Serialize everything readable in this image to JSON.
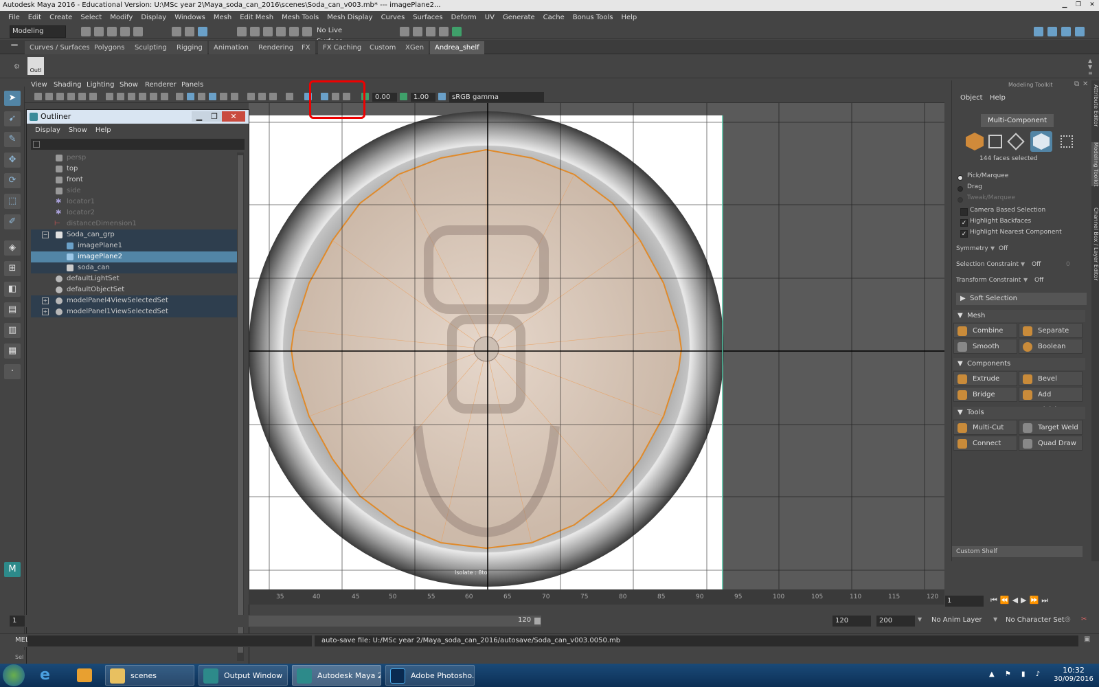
{
  "window": {
    "title": "Autodesk Maya 2016 - Educational Version: U:\\MSc year 2\\Maya_soda_can_2016\\scenes\\Soda_can_v003.mb*  ---  imagePlane2..."
  },
  "menubar": [
    "File",
    "Edit",
    "Create",
    "Select",
    "Modify",
    "Display",
    "Windows",
    "Mesh",
    "Edit Mesh",
    "Mesh Tools",
    "Mesh Display",
    "Curves",
    "Surfaces",
    "Deform",
    "UV",
    "Generate",
    "Cache",
    "Bonus Tools",
    "Help"
  ],
  "statusline": {
    "mode": "Modeling",
    "live_surface": "No Live Surface"
  },
  "shelf_tabs": [
    "Curves / Surfaces",
    "Polygons",
    "Sculpting",
    "Rigging",
    "Animation",
    "Rendering",
    "FX",
    "FX Caching",
    "Custom",
    "XGen",
    "Andrea_shelf"
  ],
  "shelf_icon_label": "Outl",
  "viewport": {
    "menu": [
      "View",
      "Shading",
      "Lighting",
      "Show",
      "Renderer",
      "Panels"
    ],
    "exposure": "0.00",
    "gamma": "1.00",
    "colorspace": "sRGB gamma",
    "isolate_label": "Isolate : 8to"
  },
  "outliner": {
    "title": "Outliner",
    "menu": [
      "Display",
      "Show",
      "Help"
    ],
    "items": [
      {
        "label": "persp",
        "dim": true
      },
      {
        "label": "top",
        "dim": false
      },
      {
        "label": "front",
        "dim": false
      },
      {
        "label": "side",
        "dim": true
      },
      {
        "label": "locator1",
        "dim": true
      },
      {
        "label": "locator2",
        "dim": true
      },
      {
        "label": "distanceDimension1",
        "dim": true
      },
      {
        "label": "Soda_can_grp",
        "dim": false
      },
      {
        "label": "imagePlane1",
        "dim": false
      },
      {
        "label": "imagePlane2",
        "dim": false
      },
      {
        "label": "soda_can",
        "dim": false
      },
      {
        "label": "defaultLightSet",
        "dim": false
      },
      {
        "label": "defaultObjectSet",
        "dim": false
      },
      {
        "label": "modelPanel4ViewSelectedSet",
        "dim": false
      },
      {
        "label": "modelPanel1ViewSelectedSet",
        "dim": false
      }
    ]
  },
  "toolkit": {
    "title": "Modeling Toolkit",
    "menu": [
      "Object",
      "Help"
    ],
    "multi_component": "Multi-Component",
    "selection_count": "144 faces selected",
    "pick_marquee": "Pick/Marquee",
    "drag": "Drag",
    "tweak_marquee": "Tweak/Marquee",
    "camera_based": "Camera Based Selection",
    "highlight_backfaces": "Highlight Backfaces",
    "highlight_nearest": "Highlight Nearest Component",
    "symmetry_label": "Symmetry",
    "symmetry_value": "Off",
    "sel_constraint_label": "Selection Constraint",
    "sel_constraint_value": "Off",
    "sel_constraint_num": "0",
    "transform_constraint_label": "Transform Constraint",
    "transform_constraint_value": "Off",
    "soft_selection": "Soft Selection",
    "mesh_header": "Mesh",
    "mesh_buttons": [
      "Combine",
      "Separate",
      "Smooth",
      "Boolean"
    ],
    "components_header": "Components",
    "components_buttons": [
      "Extrude",
      "Bevel",
      "Bridge",
      "Add Divisions"
    ],
    "tools_header": "Tools",
    "tools_buttons": [
      "Multi-Cut",
      "Target Weld",
      "Connect",
      "Quad Draw"
    ],
    "custom_shelf": "Custom Shelf"
  },
  "side_tabs": [
    "Attribute Editor",
    "Modeling Toolkit",
    "Channel Box / Layer Editor"
  ],
  "timeline": {
    "ticks": [
      "35",
      "40",
      "45",
      "50",
      "55",
      "60",
      "65",
      "70",
      "75",
      "80",
      "85",
      "90",
      "95",
      "100",
      "105",
      "110",
      "115",
      "120"
    ],
    "current_frame": "1",
    "start_frame": "1",
    "range_end": "120",
    "end_a": "120",
    "end_b": "200",
    "anim_layer": "No Anim Layer",
    "character_set": "No Character Set"
  },
  "cmdline": {
    "mel": "MEL",
    "sel_prefix": "Sel",
    "message": "auto-save file: U:/MSc year 2/Maya_soda_can_2016/autosave/Soda_can_v003.0050.mb"
  },
  "taskbar": {
    "items": [
      "scenes",
      "Output Window",
      "Autodesk Maya 2...",
      "Adobe Photosho..."
    ],
    "time": "10:32",
    "date": "30/09/2016"
  }
}
